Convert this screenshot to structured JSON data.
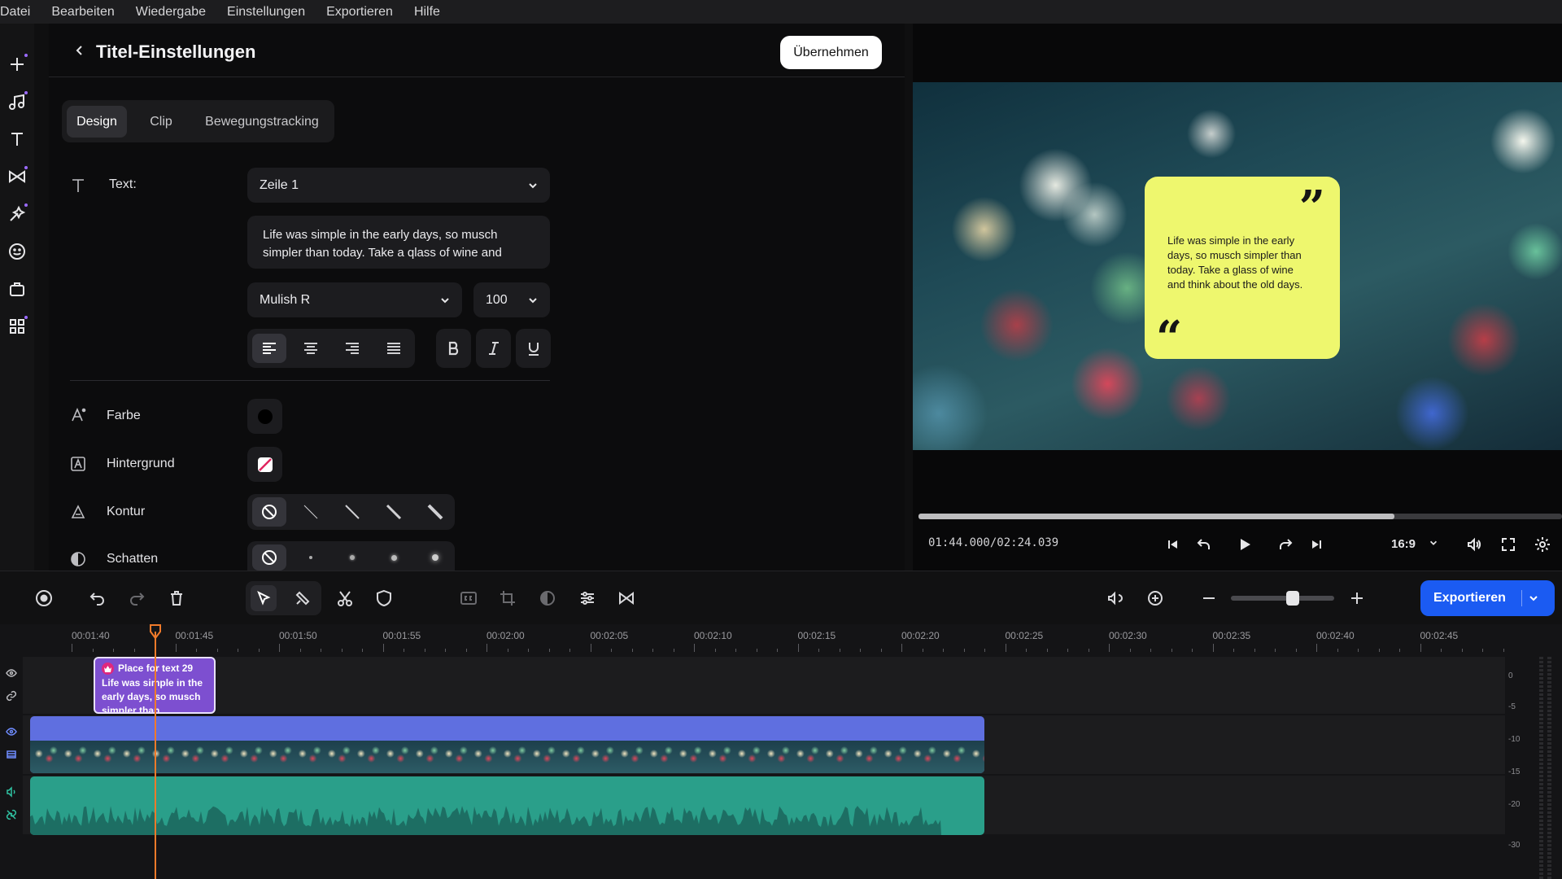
{
  "menu": [
    "Datei",
    "Bearbeiten",
    "Wiedergabe",
    "Einstellungen",
    "Exportieren",
    "Hilfe"
  ],
  "rail": {
    "icons": [
      "plus-icon",
      "music-icon",
      "text-icon",
      "transition-icon",
      "effects-icon",
      "sticker-icon",
      "templates-icon",
      "more-apps-icon"
    ]
  },
  "panel": {
    "title": "Titel-Einstellungen",
    "apply_label": "Übernehmen",
    "tabs": [
      {
        "label": "Design",
        "active": true
      },
      {
        "label": "Clip",
        "active": false
      },
      {
        "label": "Bewegungstracking",
        "active": false
      }
    ],
    "text_label": "Text:",
    "line_select": "Zeile 1",
    "text_value": "Life was simple in the early days, so musch simpler than today. Take a qlass of wine and",
    "font_select": "Mulish R",
    "size_select": "100",
    "color_label": "Farbe",
    "background_label": "Hintergrund",
    "outline_label": "Kontur",
    "shadow_label": "Schatten"
  },
  "preview": {
    "quote_text": "Life was simple in the early days, so musch simpler than today. Take a glass of wine and think about the old days.",
    "quote_open": "“",
    "quote_close": "”",
    "timecode": "01:44.000/02:24.039",
    "progress": 0.74,
    "aspect_ratio": "16:9",
    "card_color": "#eef76e"
  },
  "toolbar": {
    "export_label": "Exportieren",
    "zoom_level": 0.55
  },
  "timeline": {
    "ruler_labels": [
      "00:01:40",
      "00:01:45",
      "00:01:50",
      "00:01:55",
      "00:02:00",
      "00:02:05",
      "00:02:10",
      "00:02:15",
      "00:02:20",
      "00:02:25",
      "00:02:30",
      "00:02:35",
      "00:02:40",
      "00:02:45"
    ],
    "text_clip": {
      "name": "Place for text 29",
      "body": "Life was simple in the early days, so musch simpler than"
    },
    "meter_labels": [
      "0",
      "-5",
      "-10",
      "-15",
      "-20",
      "-30"
    ]
  },
  "colors": {
    "accent_blue": "#1b5bf2",
    "playhead": "#f07a2a",
    "text_clip": "#7d4fd0",
    "video_clip": "#5f6fe0",
    "audio_clip": "#2a9f8a"
  }
}
